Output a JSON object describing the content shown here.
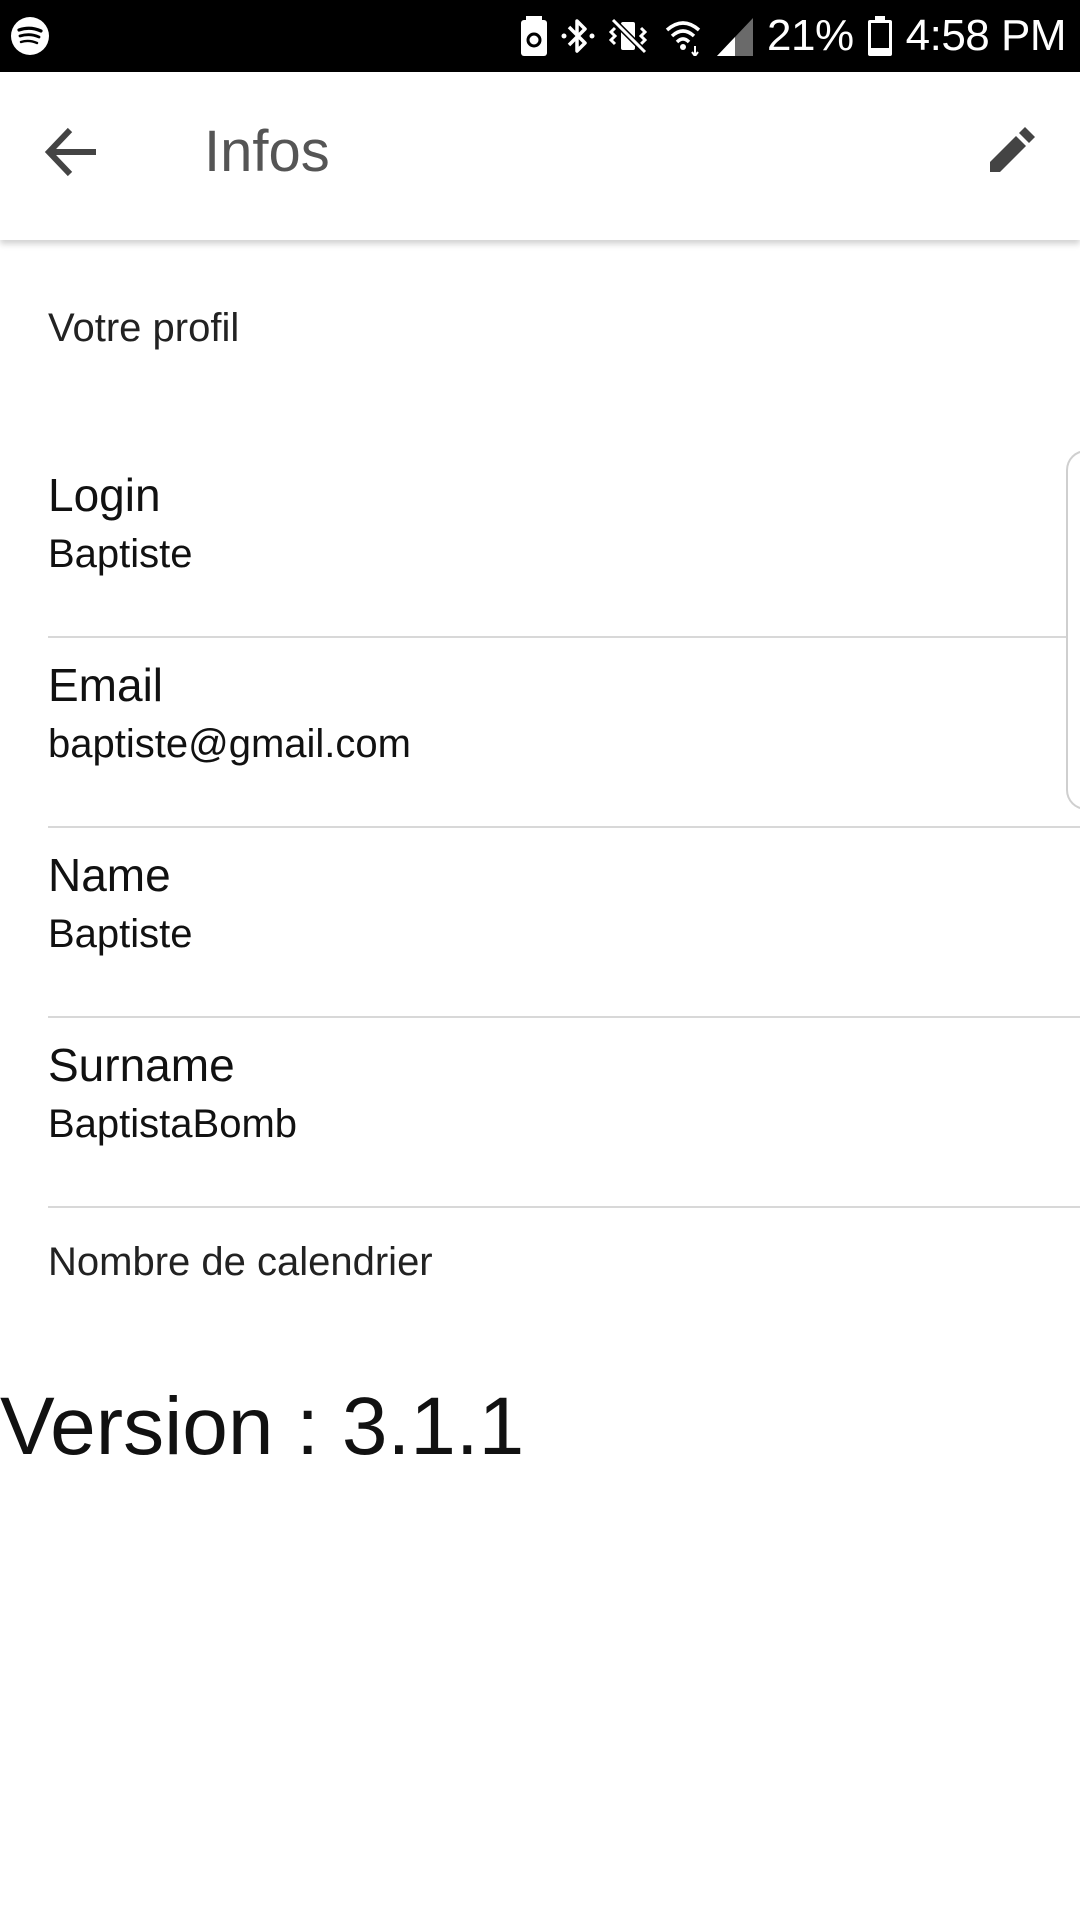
{
  "status_bar": {
    "battery_percent": "21%",
    "time": "4:58 PM",
    "icons": [
      "spotify-icon",
      "battery-saver-icon",
      "bluetooth-icon",
      "vibrate-icon",
      "wifi-icon",
      "signal-icon",
      "battery-icon"
    ]
  },
  "app_bar": {
    "title": "Infos",
    "back_icon": "arrow-back-icon",
    "edit_icon": "pencil-icon"
  },
  "profile": {
    "section_title": "Votre profil",
    "fields": [
      {
        "label": "Login",
        "value": "Baptiste"
      },
      {
        "label": "Email",
        "value": "baptiste@gmail.com"
      },
      {
        "label": "Name",
        "value": "Baptiste"
      },
      {
        "label": "Surname",
        "value": "BaptistaBomb"
      }
    ],
    "calendar_label": "Nombre de calendrier"
  },
  "version_text": "Version : 3.1.1",
  "colors": {
    "status_bar_bg": "#000000",
    "title_text": "#555555",
    "divider": "#d8d8d8"
  }
}
